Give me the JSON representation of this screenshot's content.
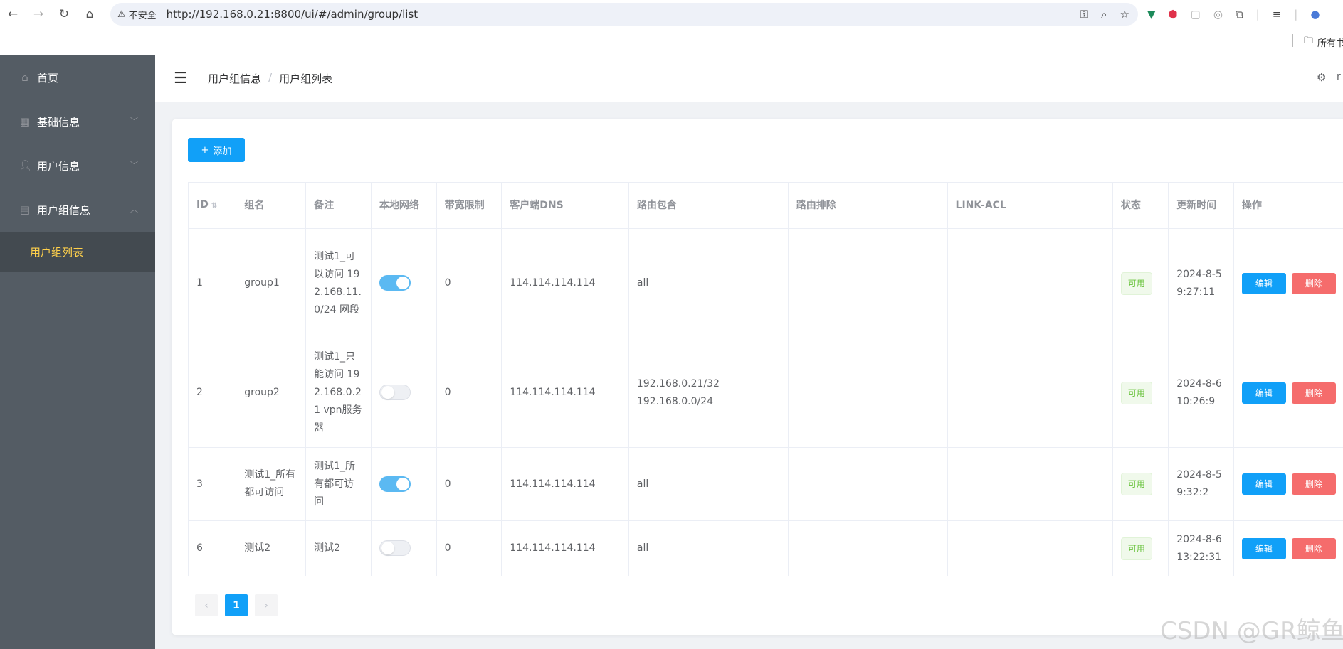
{
  "browser": {
    "security_label": "不安全",
    "url": "http://192.168.0.21:8800/ui/#/admin/group/list",
    "bookmarks_label": "所有书"
  },
  "sidebar": {
    "items": [
      {
        "label": "首页",
        "icon": "home-icon"
      },
      {
        "label": "基础信息",
        "icon": "grid-icon"
      },
      {
        "label": "用户信息",
        "icon": "user-icon"
      },
      {
        "label": "用户组信息",
        "icon": "document-icon"
      }
    ],
    "submenu_active": "用户组列表"
  },
  "header": {
    "breadcrumb": [
      "用户组信息",
      "用户组列表"
    ],
    "user_initial": "r"
  },
  "toolbar": {
    "add_label": "添加"
  },
  "table": {
    "headers": [
      "ID",
      "组名",
      "备注",
      "本地网络",
      "带宽限制",
      "客户端DNS",
      "路由包含",
      "路由排除",
      "LINK-ACL",
      "状态",
      "更新时间",
      "操作"
    ],
    "rows": [
      {
        "id": "1",
        "name": "group1",
        "note": "测试1_可以访问 192.168.11.0/24 网段",
        "local_net": true,
        "bandwidth": "0",
        "dns": "114.114.114.114",
        "route_include": [
          "all"
        ],
        "route_exclude": "",
        "link_acl": "",
        "status": "可用",
        "updated": "2024-8-5 9:27:11"
      },
      {
        "id": "2",
        "name": "group2",
        "note": "测试1_只能访问 192.168.0.21 vpn服务器",
        "local_net": false,
        "bandwidth": "0",
        "dns": "114.114.114.114",
        "route_include": [
          "192.168.0.21/32",
          "192.168.0.0/24"
        ],
        "route_exclude": "",
        "link_acl": "",
        "status": "可用",
        "updated": "2024-8-6 10:26:9"
      },
      {
        "id": "3",
        "name": "测试1_所有都可访问",
        "note": "测试1_所有都可访问",
        "local_net": true,
        "bandwidth": "0",
        "dns": "114.114.114.114",
        "route_include": [
          "all"
        ],
        "route_exclude": "",
        "link_acl": "",
        "status": "可用",
        "updated": "2024-8-5 9:32:2"
      },
      {
        "id": "6",
        "name": "测试2",
        "note": "测试2",
        "local_net": false,
        "bandwidth": "0",
        "dns": "114.114.114.114",
        "route_include": [
          "all"
        ],
        "route_exclude": "",
        "link_acl": "",
        "status": "可用",
        "updated": "2024-8-6 13:22:31"
      }
    ],
    "edit_label": "编辑",
    "delete_label": "删除"
  },
  "pagination": {
    "current_page": "1",
    "prev": "‹",
    "next": "›"
  },
  "watermark": "CSDN @GR鲸鱼",
  "colors": {
    "sidebar_bg": "#545c64",
    "active_text": "#ffd04b",
    "primary": "#11a0f8",
    "danger": "#f56c6c",
    "success": "#67c23a"
  }
}
